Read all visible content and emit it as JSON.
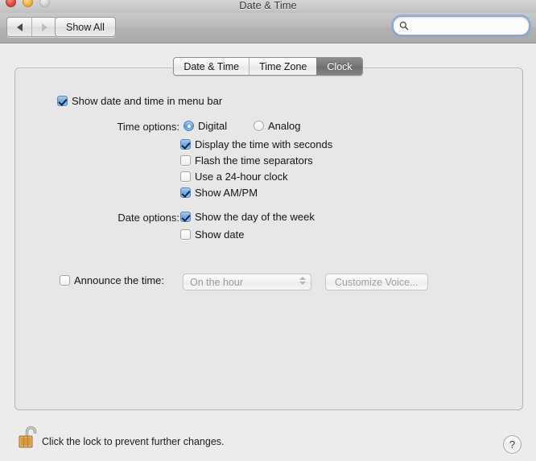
{
  "window": {
    "title": "Date & Time",
    "traffic_lights": [
      "close-button",
      "minimize-button",
      "zoom-button"
    ]
  },
  "toolbar": {
    "back_icon": "triangle-left-icon",
    "forward_icon": "triangle-right-icon",
    "show_all_label": "Show All",
    "search": {
      "icon": "search-icon",
      "value": "",
      "placeholder": ""
    }
  },
  "tabs": [
    {
      "label": "Date & Time",
      "active": false
    },
    {
      "label": "Time Zone",
      "active": false
    },
    {
      "label": "Clock",
      "active": true
    }
  ],
  "main": {
    "menu_bar_checkbox": {
      "label": "Show date and time in menu bar",
      "checked": true
    },
    "time_options": {
      "label": "Time options:",
      "radios": [
        {
          "label": "Digital",
          "selected": true
        },
        {
          "label": "Analog",
          "selected": false
        }
      ],
      "checkboxes": [
        {
          "label": "Display the time with seconds",
          "checked": true
        },
        {
          "label": "Flash the time separators",
          "checked": false
        },
        {
          "label": "Use a 24-hour clock",
          "checked": false
        },
        {
          "label": "Show AM/PM",
          "checked": true
        }
      ]
    },
    "date_options": {
      "label": "Date options:",
      "checkboxes": [
        {
          "label": "Show the day of the week",
          "checked": true
        },
        {
          "label": "Show date",
          "checked": false
        }
      ]
    },
    "announce": {
      "label": "Announce the time:",
      "checked": false,
      "popup_value": "On the hour",
      "popup_icon": "stepper-arrows-icon",
      "button_label": "Customize Voice...",
      "disabled": true
    }
  },
  "footer": {
    "lock_icon": "unlocked-padlock-icon",
    "text": "Click the lock to prevent further changes.",
    "help_label": "?"
  },
  "colors": {
    "accent_blue": "#6aa9e4",
    "window_bg": "#ececec",
    "content_bg": "#e7e7e7",
    "tab_active_bg": "#777777",
    "lock_gold": "#d79b43"
  }
}
